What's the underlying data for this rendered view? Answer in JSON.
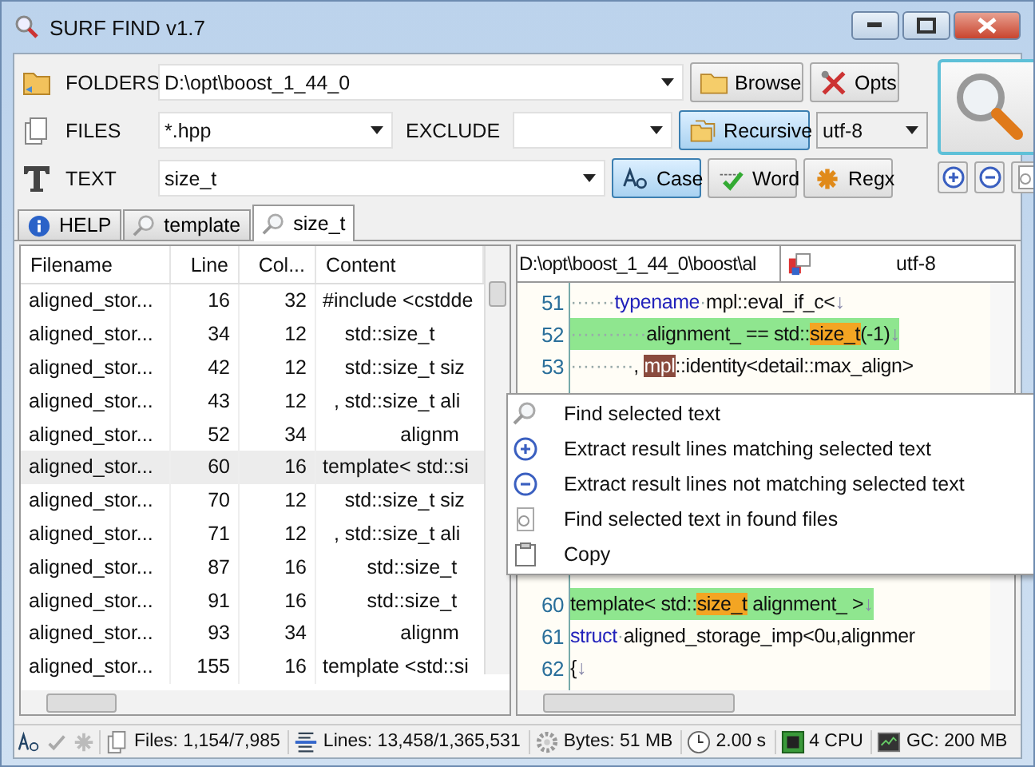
{
  "window": {
    "title": "SURF FIND  v1.7"
  },
  "toolbar": {
    "folders": {
      "label": "FOLDERS",
      "value": "D:\\opt\\boost_1_44_0"
    },
    "files": {
      "label": "FILES",
      "value": "*.hpp"
    },
    "exclude": {
      "label": "EXCLUDE"
    },
    "text": {
      "label": "TEXT",
      "value": "size_t"
    },
    "encoding": "utf-8",
    "buttons": [
      {
        "kind": "browse",
        "label": "Browse"
      },
      {
        "kind": "opts",
        "label": "Opts"
      }
    ],
    "toggles": [
      {
        "kind": "recursive",
        "label": "Recursive",
        "selected": true
      },
      {
        "kind": "case",
        "label": "Case",
        "selected": true
      },
      {
        "kind": "word",
        "label": "Word",
        "selected": false
      },
      {
        "kind": "regx",
        "label": "Regx",
        "selected": false
      }
    ]
  },
  "tabs": [
    {
      "kind": "help",
      "label": "HELP",
      "selected": false
    },
    {
      "kind": "search",
      "label": "template",
      "selected": false
    },
    {
      "kind": "search",
      "label": "size_t",
      "selected": true
    }
  ],
  "table": {
    "columns": [
      "Filename",
      "Line",
      "Col...",
      "Content"
    ],
    "rows": [
      {
        "file": "aligned_stor...",
        "line": "16",
        "col": "32",
        "content": "#include <cstdde",
        "selected": false
      },
      {
        "file": "aligned_stor...",
        "line": "34",
        "col": "12",
        "content": "    std::size_t",
        "selected": false
      },
      {
        "file": "aligned_stor...",
        "line": "42",
        "col": "12",
        "content": "    std::size_t siz",
        "selected": false
      },
      {
        "file": "aligned_stor...",
        "line": "43",
        "col": "12",
        "content": "  , std::size_t ali",
        "selected": false
      },
      {
        "file": "aligned_stor...",
        "line": "52",
        "col": "34",
        "content": "              alignm",
        "selected": false
      },
      {
        "file": "aligned_stor...",
        "line": "60",
        "col": "16",
        "content": "template< std::si",
        "selected": true
      },
      {
        "file": "aligned_stor...",
        "line": "70",
        "col": "12",
        "content": "    std::size_t siz",
        "selected": false
      },
      {
        "file": "aligned_stor...",
        "line": "71",
        "col": "12",
        "content": "  , std::size_t ali",
        "selected": false
      },
      {
        "file": "aligned_stor...",
        "line": "87",
        "col": "16",
        "content": "        std::size_t",
        "selected": false
      },
      {
        "file": "aligned_stor...",
        "line": "91",
        "col": "16",
        "content": "        std::size_t",
        "selected": false
      },
      {
        "file": "aligned_stor...",
        "line": "93",
        "col": "34",
        "content": "              alignm",
        "selected": false
      },
      {
        "file": "aligned_stor...",
        "line": "155",
        "col": "16",
        "content": "template <std::si",
        "selected": false
      }
    ]
  },
  "code_view": {
    "path": "D:\\opt\\boost_1_44_0\\boost\\al",
    "encoding": "utf-8",
    "lines_top": [
      {
        "number": "51",
        "highlighted": false,
        "segments": [
          {
            "kind": "ws",
            "text": "·······"
          },
          {
            "kind": "keyword",
            "text": "typename"
          },
          {
            "kind": "ws",
            "text": "·"
          },
          {
            "kind": "text",
            "text": "mpl::eval_if_c<"
          },
          {
            "kind": "eol",
            "text": "↓"
          }
        ]
      },
      {
        "number": "52",
        "highlighted": true,
        "segments": [
          {
            "kind": "ws",
            "text": "············"
          },
          {
            "kind": "text",
            "text": "alignment_ == std::"
          },
          {
            "kind": "match",
            "text": "size_t"
          },
          {
            "kind": "text",
            "text": "(-1)"
          },
          {
            "kind": "eol",
            "text": "↓"
          }
        ]
      },
      {
        "number": "53",
        "highlighted": false,
        "segments": [
          {
            "kind": "ws",
            "text": "··········"
          },
          {
            "kind": "text",
            "text": ", "
          },
          {
            "kind": "selection",
            "text": "mpl"
          },
          {
            "kind": "text",
            "text": "::identity<detail::max_align>"
          }
        ]
      }
    ],
    "lines_bottom": [
      {
        "number": "60",
        "highlighted": true,
        "segments": [
          {
            "kind": "text",
            "text": "template< std::"
          },
          {
            "kind": "match",
            "text": "size_t"
          },
          {
            "kind": "text",
            "text": " alignment_ >"
          },
          {
            "kind": "eol",
            "text": "↓"
          }
        ]
      },
      {
        "number": "61",
        "highlighted": false,
        "segments": [
          {
            "kind": "keyword",
            "text": "struct"
          },
          {
            "kind": "ws",
            "text": "·"
          },
          {
            "kind": "text",
            "text": "aligned_storage_imp<0u,alignmer"
          }
        ]
      },
      {
        "number": "62",
        "highlighted": false,
        "segments": [
          {
            "kind": "text",
            "text": "{"
          },
          {
            "kind": "eol",
            "text": "↓"
          }
        ]
      }
    ]
  },
  "context_menu": [
    {
      "kind": "find",
      "label": "Find selected text"
    },
    {
      "kind": "plus",
      "label": "Extract result lines matching selected text"
    },
    {
      "kind": "minus",
      "label": "Extract result lines not matching selected text"
    },
    {
      "kind": "findfiles",
      "label": "Find selected text in found files"
    },
    {
      "kind": "copy",
      "label": "Copy"
    }
  ],
  "status_bar": [
    {
      "kind": "files",
      "text": "Files: 1,154/7,985"
    },
    {
      "kind": "lines",
      "text": "Lines: 13,458/1,365,531"
    },
    {
      "kind": "bytes",
      "text": "Bytes: 51 MB"
    },
    {
      "kind": "time",
      "text": "2.00 s"
    },
    {
      "kind": "cpu",
      "text": "4 CPU"
    },
    {
      "kind": "gc",
      "text": "GC: 200 MB"
    }
  ]
}
